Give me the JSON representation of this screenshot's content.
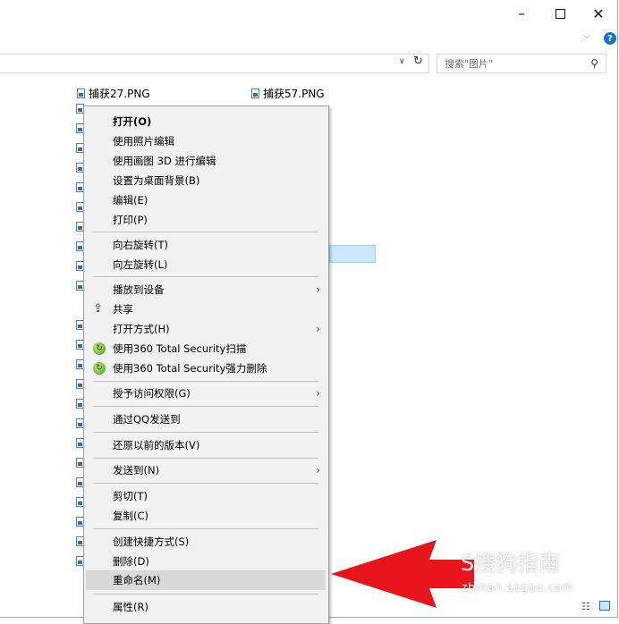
{
  "window": {
    "minimize_glyph": "–",
    "close_glyph": "✕",
    "chevron_glyph": "⌵",
    "help_glyph": "?"
  },
  "address": {
    "dropdown_glyph": "∨",
    "refresh_glyph": "↻"
  },
  "search": {
    "placeholder": "搜索\"图片\"",
    "icon_glyph": "⚲"
  },
  "files": {
    "col1_name": "捕获27.PNG",
    "col2_name": "捕获57.PNG"
  },
  "context_menu": {
    "items": [
      {
        "label": "打开(O)"
      },
      {
        "label": "使用照片编辑"
      },
      {
        "label": "使用画图 3D 进行编辑"
      },
      {
        "label": "设置为桌面背景(B)"
      },
      {
        "label": "编辑(E)"
      },
      {
        "label": "打印(P)"
      },
      {
        "label": "向右旋转(T)"
      },
      {
        "label": "向左旋转(L)"
      },
      {
        "label": "播放到设备"
      },
      {
        "label": "共享"
      },
      {
        "label": "打开方式(H)"
      },
      {
        "label": "使用360 Total Security扫描"
      },
      {
        "label": "使用360 Total Security强力删除"
      },
      {
        "label": "授予访问权限(G)"
      },
      {
        "label": "通过QQ发送到"
      },
      {
        "label": "还原以前的版本(V)"
      },
      {
        "label": "发送到(N)"
      },
      {
        "label": "剪切(T)"
      },
      {
        "label": "复制(C)"
      },
      {
        "label": "创建快捷方式(S)"
      },
      {
        "label": "删除(D)"
      },
      {
        "label": "重命名(M)"
      },
      {
        "label": "属性(R)"
      }
    ],
    "submenu_glyph": "›"
  },
  "watermark": {
    "brand": "S搜狗指南",
    "url": "zhinan.sogou.com"
  },
  "colors": {
    "accent": "#1a73c8",
    "arrow": "#e8141b",
    "highlight": "#d9d9d9"
  }
}
